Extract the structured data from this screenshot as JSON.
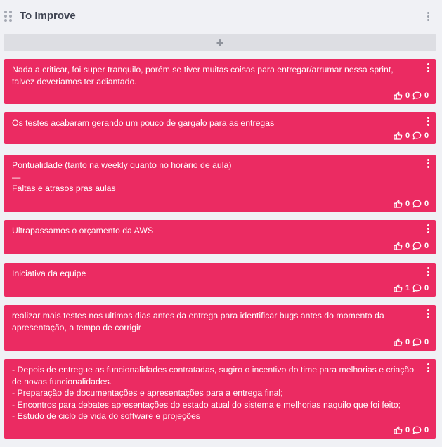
{
  "column": {
    "title": "To Improve",
    "add_label": "+"
  },
  "colors": {
    "card": "#eb2b62",
    "background": "#f0f1f5",
    "add_button": "#dddee3",
    "title": "#3f4452"
  },
  "icons": {
    "drag": "drag-handle-icon",
    "menu": "vertical-dots-icon",
    "like": "thumbs-up-icon",
    "comment": "comment-bubble-icon"
  },
  "cards": [
    {
      "text": "Nada a criticar, foi super tranquilo, porém se tiver muitas coisas para entregar/arrumar nessa sprint, talvez deveriamos ter adiantado.",
      "likes": "0",
      "comments": "0"
    },
    {
      "text": "Os testes acabaram gerando um pouco de gargalo para as entregas",
      "likes": "0",
      "comments": "0"
    },
    {
      "text": "Pontualidade (tanto na weekly quanto no horário de aula)\n—\nFaltas e atrasos pras aulas",
      "likes": "0",
      "comments": "0"
    },
    {
      "text": "Ultrapassamos o orçamento da AWS",
      "likes": "0",
      "comments": "0"
    },
    {
      "text": "Iniciativa da equipe",
      "likes": "1",
      "comments": "0"
    },
    {
      "text": "realizar mais testes nos ultimos dias antes da entrega para identificar bugs antes do momento da apresentação, a tempo de corrigir",
      "likes": "0",
      "comments": "0"
    },
    {
      "text": "- Depois de entregue as funcionalidades contratadas, sugiro o incentivo do time para melhorias e criação de novas funcionalidades.\n- Preparação de documentações e apresentações para a entrega final;\n- Encontros para debates apresentações do estado atual do sistema e melhorias naquilo que foi feito;\n- Estudo de ciclo de vida do software e projeções",
      "likes": "0",
      "comments": "0"
    }
  ]
}
